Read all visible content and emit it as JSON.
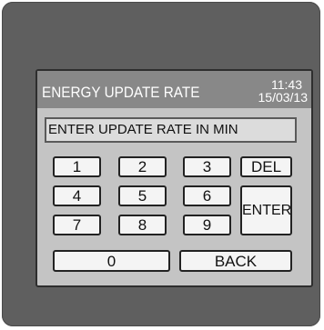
{
  "header": {
    "title": "ENERGY UPDATE RATE",
    "time": "11:43",
    "date": "15/03/13"
  },
  "entry": {
    "prompt": "ENTER UPDATE RATE IN MIN"
  },
  "keypad": {
    "k1": "1",
    "k2": "2",
    "k3": "3",
    "k4": "4",
    "k5": "5",
    "k6": "6",
    "k7": "7",
    "k8": "8",
    "k9": "9",
    "k0": "0",
    "del": "DEL",
    "enter": "ENTER",
    "back": "BACK"
  },
  "colors": {
    "bezel": "#5f5f5f",
    "screen": "#c4c4c4",
    "titlebar": "#888888",
    "key": "#f4f4f4"
  }
}
